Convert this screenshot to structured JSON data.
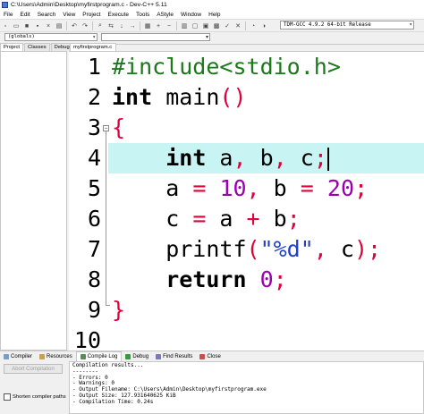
{
  "window": {
    "title": "C:\\Users\\Admin\\Desktop\\myfirstprogram.c - Dev-C++ 5.11"
  },
  "menu": [
    "File",
    "Edit",
    "Search",
    "View",
    "Project",
    "Execute",
    "Tools",
    "AStyle",
    "Window",
    "Help"
  ],
  "toolbar": {
    "compiler": "TDM-GCC 4.9.2 64-bit Release",
    "scope": "(globals)"
  },
  "left_tabs": [
    "Project",
    "Classes",
    "Debug"
  ],
  "file_tab": "myfirstprogram.c",
  "editor": {
    "current_line": 4,
    "lines": [
      {
        "n": "1",
        "text": "#include<stdio.h>"
      },
      {
        "n": "2",
        "text": "int main()"
      },
      {
        "n": "3",
        "text": "{"
      },
      {
        "n": "4",
        "text": "    int a, b, c;"
      },
      {
        "n": "5",
        "text": "    a = 10, b = 20;"
      },
      {
        "n": "6",
        "text": "    c = a + b;"
      },
      {
        "n": "7",
        "text": "    printf(\"%d\", c);"
      },
      {
        "n": "8",
        "text": "    return 0;"
      },
      {
        "n": "9",
        "text": "}"
      },
      {
        "n": "10",
        "text": ""
      }
    ]
  },
  "bottom_tabs": [
    "Compiler",
    "Resources",
    "Compile Log",
    "Debug",
    "Find Results",
    "Close"
  ],
  "bottom_panel": {
    "abort_label": "Abort Compilation",
    "shorten_label": "Shorten compiler paths",
    "log": [
      "Compilation results...",
      "--------",
      "- Errors: 0",
      "- Warnings: 0",
      "- Output Filename: C:\\Users\\Admin\\Desktop\\myfirstprogram.exe",
      "- Output Size: 127.931640625 KiB",
      "- Compilation Time: 0.24s"
    ]
  },
  "colors": {
    "current_line": "#c8f4f4",
    "preprocessor": "#1a7a1a",
    "symbol": "#e0003a",
    "number": "#9b00b0",
    "string": "#1f3fc8"
  }
}
